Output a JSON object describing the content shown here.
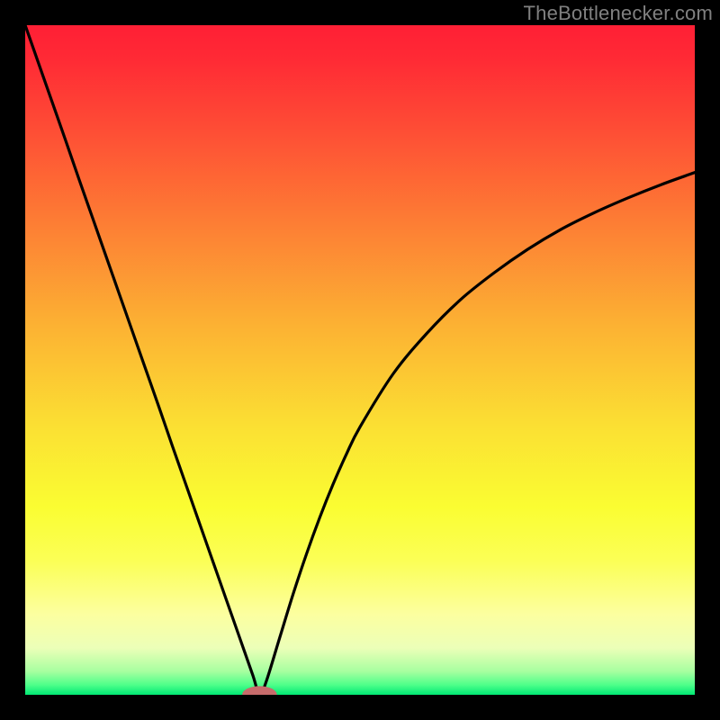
{
  "attribution": "TheBottlenecker.com",
  "gradient": {
    "stops": [
      {
        "offset": 0.0,
        "color": "#ff1f35"
      },
      {
        "offset": 0.05,
        "color": "#ff2a35"
      },
      {
        "offset": 0.15,
        "color": "#fe4b35"
      },
      {
        "offset": 0.3,
        "color": "#fd7f34"
      },
      {
        "offset": 0.45,
        "color": "#fcb233"
      },
      {
        "offset": 0.6,
        "color": "#fbe033"
      },
      {
        "offset": 0.72,
        "color": "#fafd32"
      },
      {
        "offset": 0.8,
        "color": "#fbff56"
      },
      {
        "offset": 0.88,
        "color": "#fcffa0"
      },
      {
        "offset": 0.93,
        "color": "#ecffb8"
      },
      {
        "offset": 0.965,
        "color": "#a7ffa0"
      },
      {
        "offset": 0.985,
        "color": "#4fff8a"
      },
      {
        "offset": 1.0,
        "color": "#00e874"
      }
    ]
  },
  "chart_data": {
    "type": "line",
    "title": "",
    "xlabel": "",
    "ylabel": "",
    "xlim": [
      0,
      100
    ],
    "ylim": [
      0,
      100
    ],
    "grid": false,
    "legend": false,
    "series": [
      {
        "name": "bottleneck-curve",
        "x": [
          0,
          2,
          4,
          6,
          8,
          10,
          12,
          14,
          16,
          18,
          20,
          22,
          24,
          26,
          28,
          30,
          32,
          34,
          35,
          36,
          38,
          40,
          42,
          44,
          46,
          48,
          50,
          55,
          60,
          65,
          70,
          75,
          80,
          85,
          90,
          95,
          100
        ],
        "y": [
          100,
          94.3,
          88.6,
          82.9,
          77.1,
          71.4,
          65.7,
          60.0,
          54.3,
          48.6,
          42.9,
          37.1,
          31.4,
          25.7,
          20.0,
          14.3,
          8.6,
          2.9,
          0.0,
          2.0,
          8.5,
          15.0,
          21.0,
          26.5,
          31.5,
          36.0,
          40.0,
          48.0,
          54.0,
          59.0,
          63.0,
          66.5,
          69.5,
          72.0,
          74.2,
          76.2,
          78.0
        ]
      }
    ],
    "marker": {
      "name": "optimal-point",
      "x": 35,
      "y": 0,
      "color": "#c76b6b",
      "rx_pct": 2.6,
      "ry_pct": 1.3
    }
  }
}
